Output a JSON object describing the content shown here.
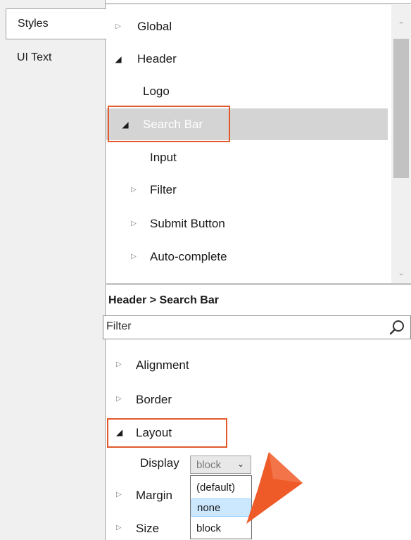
{
  "tabs": {
    "styles": "Styles",
    "ui_text": "UI Text"
  },
  "tree": {
    "items": [
      {
        "label": "Global",
        "expander": "collapsed"
      },
      {
        "label": "Header",
        "expander": "expanded"
      },
      {
        "label": "Logo",
        "expander": "none"
      },
      {
        "label": "Search Bar",
        "expander": "expanded",
        "selected": true
      },
      {
        "label": "Input",
        "expander": "none"
      },
      {
        "label": "Filter",
        "expander": "collapsed"
      },
      {
        "label": "Submit Button",
        "expander": "collapsed"
      },
      {
        "label": "Auto-complete",
        "expander": "collapsed"
      }
    ]
  },
  "breadcrumb": "Header > Search Bar",
  "filter": {
    "placeholder": "Filter",
    "icon": "search-icon"
  },
  "properties": {
    "groups": [
      {
        "label": "Alignment",
        "expander": "collapsed"
      },
      {
        "label": "Border",
        "expander": "collapsed"
      },
      {
        "label": "Layout",
        "expander": "expanded"
      },
      {
        "label": "Margin",
        "expander": "collapsed"
      },
      {
        "label": "Size",
        "expander": "collapsed"
      }
    ],
    "display_label": "Display",
    "display_value": "block",
    "display_options": [
      "(default)",
      "none",
      "block"
    ],
    "hovered_option": "none"
  },
  "colors": {
    "highlight_box": "#e2592c",
    "pointer": "#ef5a29",
    "selection": "#d4d4d4",
    "hover": "#cce8ff"
  }
}
